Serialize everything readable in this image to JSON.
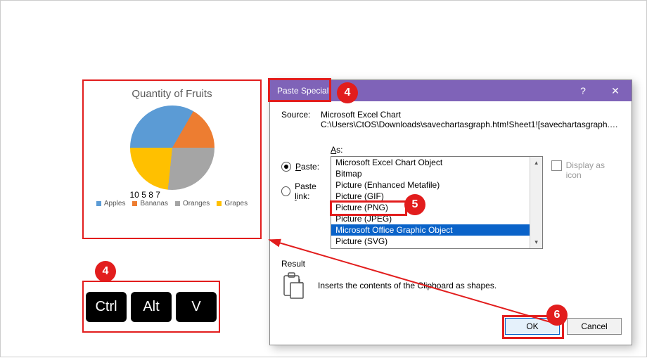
{
  "colors": {
    "accent_red": "#e21d1d",
    "dlg_title": "#7f63b8",
    "sel_blue": "#0a63c9",
    "grey_text": "#595959",
    "series": {
      "apples": "#5b9bd5",
      "bananas": "#ed7d31",
      "oranges": "#a5a5a5",
      "grapes": "#ffc000"
    }
  },
  "chart": {
    "title": "Quantity of Fruits",
    "legend": [
      {
        "key": "apples",
        "label": "Apples"
      },
      {
        "key": "bananas",
        "label": "Bananas"
      },
      {
        "key": "oranges",
        "label": "Oranges"
      },
      {
        "key": "grapes",
        "label": "Grapes"
      }
    ]
  },
  "chart_data": {
    "type": "pie",
    "title": "Quantity of Fruits",
    "categories": [
      "Apples",
      "Bananas",
      "Oranges",
      "Grapes"
    ],
    "values": [
      10,
      5,
      8,
      7
    ],
    "colors": [
      "#5b9bd5",
      "#ed7d31",
      "#a5a5a5",
      "#ffc000"
    ]
  },
  "keys": {
    "ctrl": "Ctrl",
    "alt": "Alt",
    "v": "V"
  },
  "badges": {
    "b4": "4",
    "b5": "5",
    "b6": "6"
  },
  "dialog": {
    "title": "Paste Special",
    "help": "?",
    "close": "✕",
    "source_label": "Source:",
    "source_line1": "Microsoft Excel Chart",
    "source_line2": "C:\\Users\\CtOS\\Downloads\\savechartasgraph.htm!Sheet1![savechartasgraph.htm]Shee...",
    "paste_label": "Paste:",
    "paste_link_label": "Paste link:",
    "as_prefix": "A",
    "as_suffix": "s:",
    "options": [
      "Microsoft Excel Chart Object",
      "Bitmap",
      "Picture (Enhanced Metafile)",
      "Picture (GIF)",
      "Picture (PNG)",
      "Picture (JPEG)",
      "Microsoft Office Graphic Object",
      "Picture (SVG)"
    ],
    "selected_index": 6,
    "highlighted_index": 4,
    "display_as_icon": "Display as icon",
    "result_label": "Result",
    "result_desc": "Inserts the contents of the Clipboard as shapes.",
    "ok": "OK",
    "cancel": "Cancel"
  }
}
